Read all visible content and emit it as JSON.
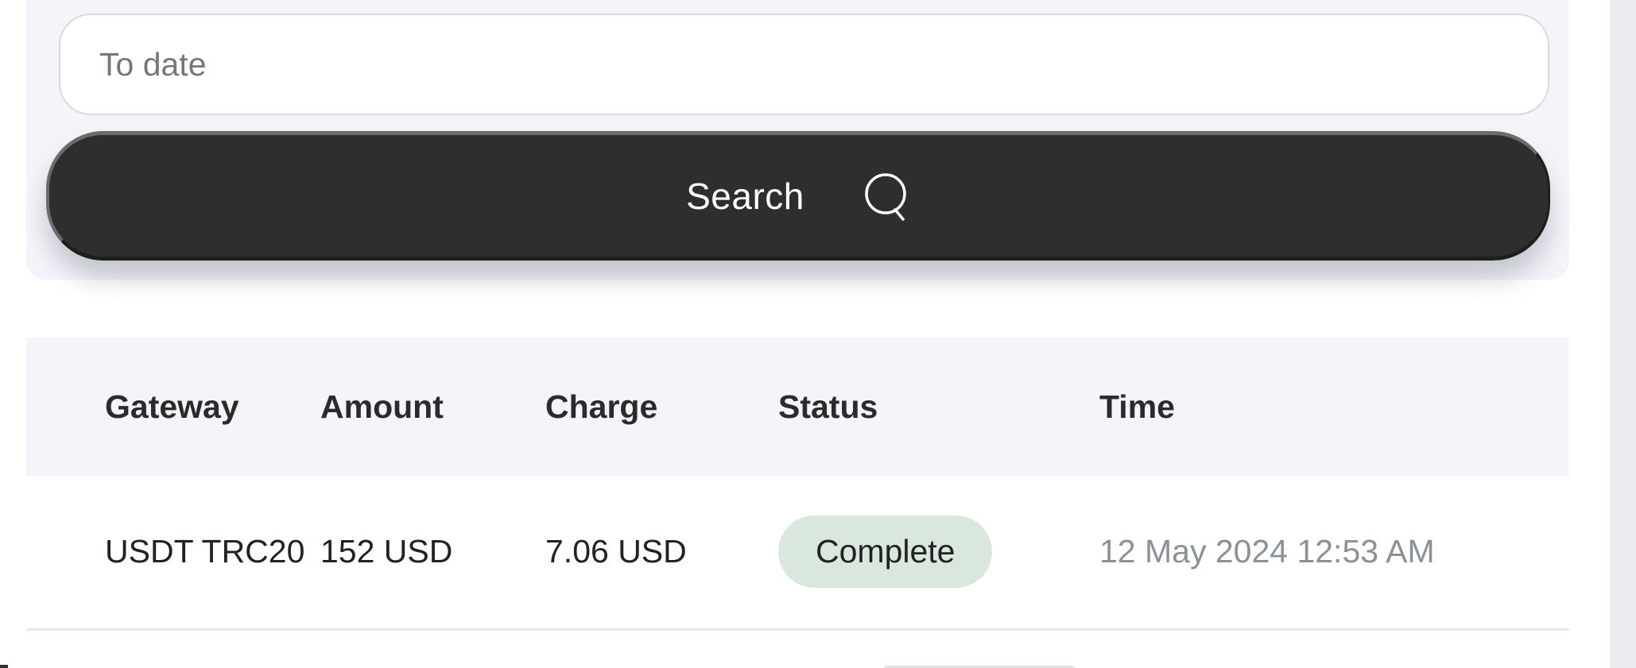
{
  "filters": {
    "to_date_placeholder": "To date",
    "to_date_value": "",
    "search_button_label": "Search",
    "search_icon": "search-icon"
  },
  "table": {
    "columns": [
      "Gateway",
      "Amount",
      "Charge",
      "Status",
      "Time"
    ],
    "rows": [
      {
        "gateway": "USDT TRC20",
        "amount": "152 USD",
        "charge": "7.06 USD",
        "status": "Complete",
        "time": "12 May 2024 12:53 AM"
      }
    ]
  },
  "colors": {
    "button_bg": "#2e2e2e",
    "card_bg": "#f4f5fa",
    "status_complete_bg": "#d9e7de",
    "time_text": "#8a9197"
  }
}
